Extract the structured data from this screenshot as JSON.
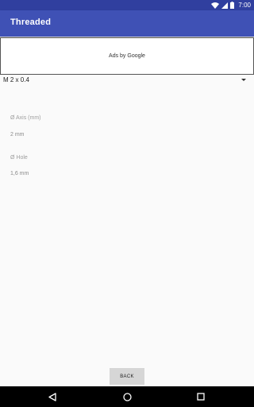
{
  "status_bar": {
    "time": "7:00",
    "icons": [
      "wifi-icon",
      "signal-icon",
      "battery-icon"
    ]
  },
  "app_bar": {
    "title": "Threaded",
    "color": "#3f51b5",
    "status_color": "#303f9f"
  },
  "ad": {
    "text": "Ads by Google"
  },
  "spinner": {
    "selected": "M 2 x 0.4"
  },
  "fields": {
    "axis_label": "Ø Axis (mm)",
    "axis_value": "2 mm",
    "hole_label": "Ø Hole",
    "hole_value": "1,6 mm"
  },
  "buttons": {
    "back_label": "BACK"
  },
  "nav": {
    "icons": [
      "back-nav-icon",
      "home-nav-icon",
      "recents-nav-icon"
    ]
  }
}
